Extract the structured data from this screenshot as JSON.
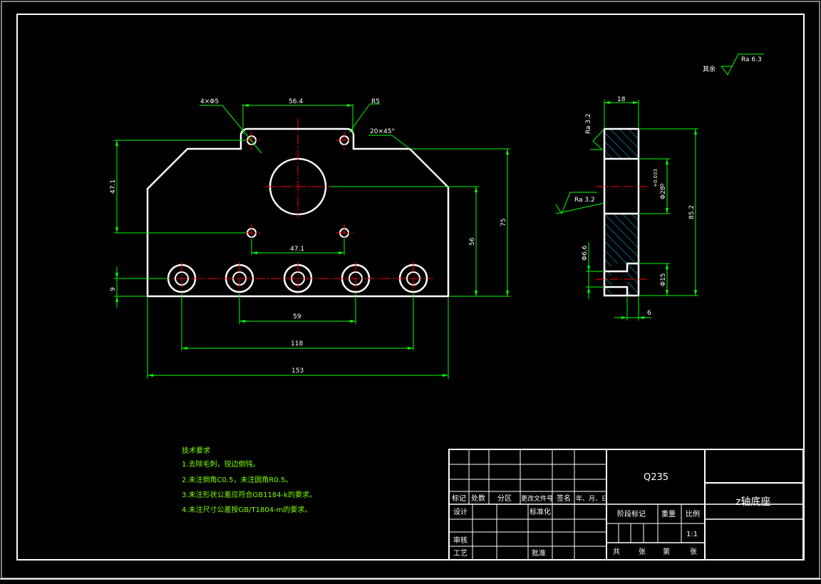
{
  "roughness_general": {
    "prefix": "其余",
    "value": "Ra 6.3"
  },
  "front_view": {
    "callouts": {
      "holes": "4×Φ5",
      "radius": "R5",
      "chamfer": "20×45°"
    },
    "dims": {
      "top_holes": "56.4",
      "left_height": "47.1",
      "mid_holes": "47.1",
      "center_height": "56",
      "total_height": "75",
      "bottom_offset": "9",
      "span_inner": "59",
      "span_outer": "118",
      "total_width": "153"
    }
  },
  "side_view": {
    "dims": {
      "thickness": "18",
      "bore": "Φ28",
      "bore_tol_upper": "+0.033",
      "bore_tol_lower": "0",
      "height": "85.2",
      "small_hole": "Φ6.6",
      "counterbore": "Φ15",
      "depth": "6"
    },
    "roughness": {
      "top": "Ra 3.2",
      "mid": "Ra 3.2"
    }
  },
  "tech_requirements": {
    "title": "技术要求",
    "items": [
      "1.去除毛刺，锐边倒钝。",
      "2.未注倒角C0.5，未注圆角R0.5。",
      "3.未注形状公差应符合GB1184-k的要求。",
      "4.未注尺寸公差按GB/T1804-m的要求。"
    ]
  },
  "title_block": {
    "material": "Q235",
    "part_name": "z轴底座",
    "rev_headers": [
      "标记",
      "处数",
      "分区",
      "更改文件号",
      "签名",
      "年、月、日"
    ],
    "labels": {
      "design": "设计",
      "standardize": "标准化",
      "review": "审核",
      "process": "工艺",
      "approve": "批准",
      "stage": "阶段标记",
      "weight": "重量",
      "scale": "比例",
      "scale_value": "1:1",
      "total": "共",
      "sheets": "张",
      "page": "第",
      "page_sheets": "张"
    }
  },
  "colors": {
    "outline": "#ffffff",
    "dimension": "#00ff00",
    "center": "#ff0000",
    "hatch": "#00c8ff",
    "requirements": "#7fff00"
  }
}
